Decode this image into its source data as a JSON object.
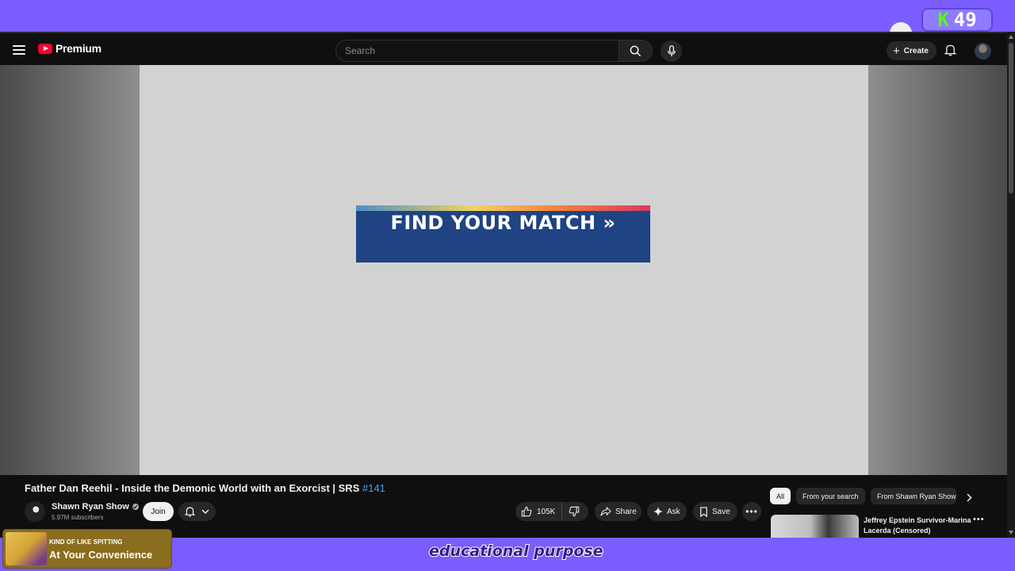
{
  "stream_overlay": {
    "badge_letter": "K",
    "badge_number": "49",
    "now_playing": {
      "subtitle": "KIND OF LIKE SPITTING",
      "title": "At Your Convenience"
    },
    "caption": "educational purpose"
  },
  "masthead": {
    "logo_text": "Premium",
    "search_placeholder": "Search",
    "create_label": "Create"
  },
  "player": {
    "ad_text": "FIND YOUR MATCH »"
  },
  "video": {
    "title": "Father Dan Reehil - Inside the Demonic World with an Exorcist | SRS ",
    "title_hashtag": "#141",
    "channel_name": "Shawn Ryan Show",
    "subscribers": "5.97M subscribers",
    "join_label": "Join",
    "like_count": "105K",
    "share_label": "Share",
    "ask_label": "Ask",
    "save_label": "Save"
  },
  "sidebar": {
    "chips": [
      "All",
      "From your search",
      "From Shawn Ryan Show"
    ],
    "recommended": [
      {
        "title": "Jeffrey Epstein Survivor-Marina Lacerda (Censored)"
      }
    ]
  },
  "colors": {
    "stream_purple": "#7b5cff",
    "youtube_red": "#ff0033",
    "link_blue": "#3ea6ff",
    "ad_blue": "#1f4383",
    "kick_green": "#53fc18"
  }
}
